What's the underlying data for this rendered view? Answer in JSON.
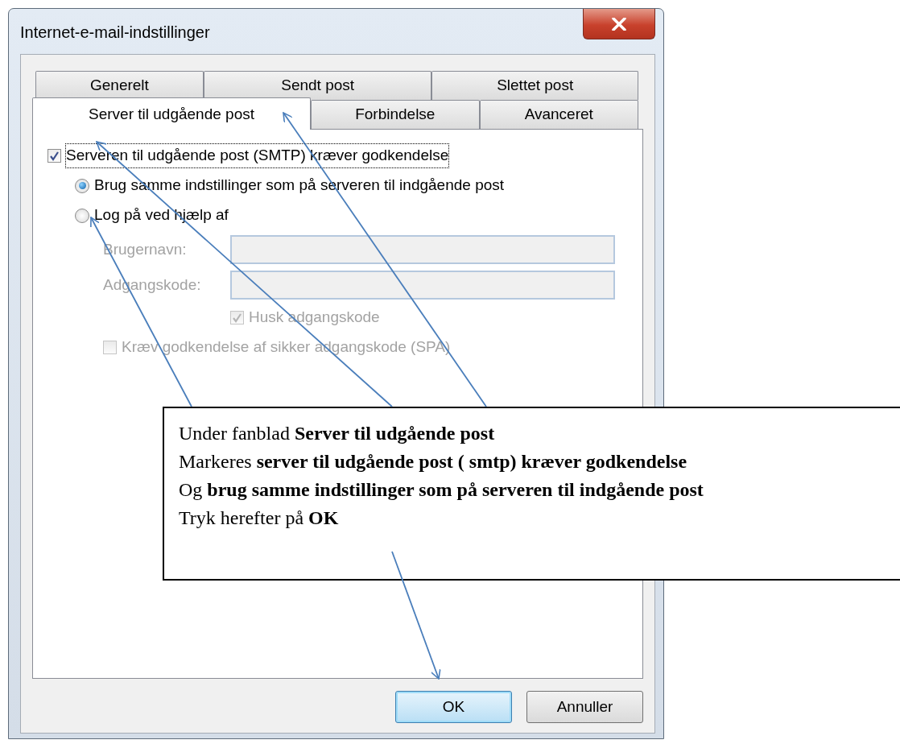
{
  "window": {
    "title": "Internet-e-mail-indstillinger"
  },
  "tab_rows": [
    {
      "tabs": [
        {
          "label": "Generelt",
          "selected": false
        },
        {
          "label": "Sendt post",
          "selected": false
        },
        {
          "label": "Slettet post",
          "selected": false
        }
      ]
    },
    {
      "tabs": [
        {
          "label": "Server til udgående post",
          "selected": true
        },
        {
          "label": "Forbindelse",
          "selected": false
        },
        {
          "label": "Avanceret",
          "selected": false
        }
      ]
    }
  ],
  "smtp_auth": {
    "label": "Serveren til udgående post (SMTP) kræver godkendelse",
    "checked": true,
    "focused": true
  },
  "sign_in_options": [
    {
      "label": "Brug samme indstillinger som på serveren til indgående post",
      "selected": true
    },
    {
      "label": "Log på ved hjælp af",
      "selected": false
    }
  ],
  "credentials": {
    "disabled": true,
    "fields": [
      {
        "label": "Brugernavn:"
      },
      {
        "label": "Adgangskode:"
      }
    ],
    "remember": {
      "label": "Husk adgangskode",
      "checked": true
    },
    "spa": {
      "label": "Kræv godkendelse af sikker adgangskode (SPA)",
      "checked": false
    }
  },
  "buttons": [
    {
      "label": "OK",
      "default": true
    },
    {
      "label": "Annuller",
      "default": false
    }
  ],
  "callout": {
    "lines": [
      "Under fanblad **Server til udgående post**",
      "Markeres **server til udgående post ( smtp) kræver godkendelse**",
      "Og **brug samme indstillinger som på serveren til indgående post**",
      "Tryk herefter på **OK**"
    ]
  }
}
